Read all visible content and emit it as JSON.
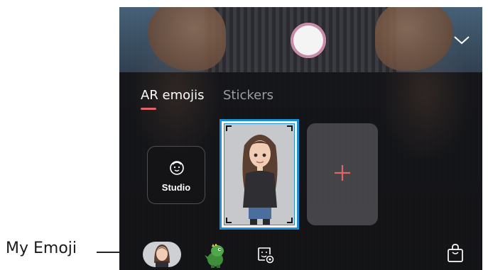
{
  "callout": {
    "label": "My Emoji"
  },
  "tabs": [
    {
      "label": "AR emojis",
      "active": true
    },
    {
      "label": "Stickers",
      "active": false
    }
  ],
  "tiles": {
    "studio_label": "Studio",
    "add_label": "+"
  },
  "colors": {
    "accent": "#e36464",
    "selection": "#1a8fd8",
    "shutter_ring": "#c98aa8"
  },
  "icons": {
    "collapse": "chevron-down-icon",
    "studio": "smiley-face-icon",
    "dino": "dinosaur-emoji-icon",
    "sticker_settings": "sticker-settings-icon",
    "shop": "shopping-bag-icon"
  }
}
